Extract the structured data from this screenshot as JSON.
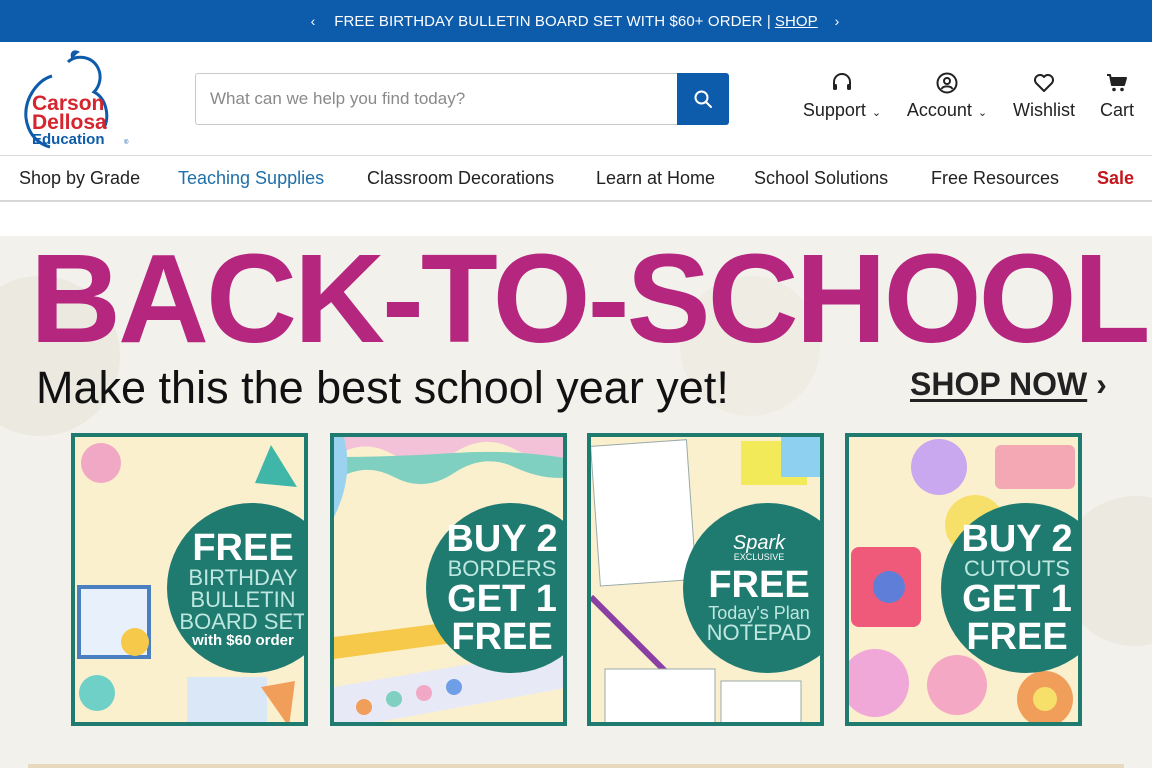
{
  "promo": {
    "text": "FREE BIRTHDAY BULLETIN BOARD SET WITH $60+ ORDER |",
    "link": "SHOP",
    "prev": "‹",
    "next": "›"
  },
  "logo": {
    "line1": "Carson",
    "line2": "Dellosa",
    "line3": "Education",
    "reg": "®"
  },
  "search": {
    "placeholder": "What can we help you find today?"
  },
  "utils": {
    "support": "Support",
    "account": "Account",
    "wishlist": "Wishlist",
    "cart": "Cart",
    "chevron": "⌄"
  },
  "nav": [
    "Shop by Grade",
    "Teaching Supplies",
    "Classroom Decorations",
    "Learn at Home",
    "School Solutions",
    "Free Resources",
    "Sale"
  ],
  "hero": {
    "headline": "BACK-TO-SCHOOL",
    "subline": "Make this the best school year yet!",
    "cta": "SHOP NOW",
    "cta_arrow": "›",
    "colors": {
      "headline": "#b5267f",
      "card_border": "#1f7a70",
      "brand_blue": "#0d5bab",
      "sale_red": "#c4161c"
    }
  },
  "cards": [
    {
      "l1": "FREE",
      "l2": "BIRTHDAY",
      "l3": "BULLETIN",
      "l4": "BOARD SET",
      "l5": "with $60 order"
    },
    {
      "l1": "BUY 2",
      "l2": "BORDERS",
      "l3": "GET 1",
      "l4": "FREE"
    },
    {
      "brand": "Spark",
      "exclusive": "EXCLUSIVE",
      "l1": "FREE",
      "l2": "Today's Plan",
      "l3": "NOTEPAD"
    },
    {
      "l1": "BUY 2",
      "l2": "CUTOUTS",
      "l3": "GET 1",
      "l4": "FREE"
    }
  ]
}
